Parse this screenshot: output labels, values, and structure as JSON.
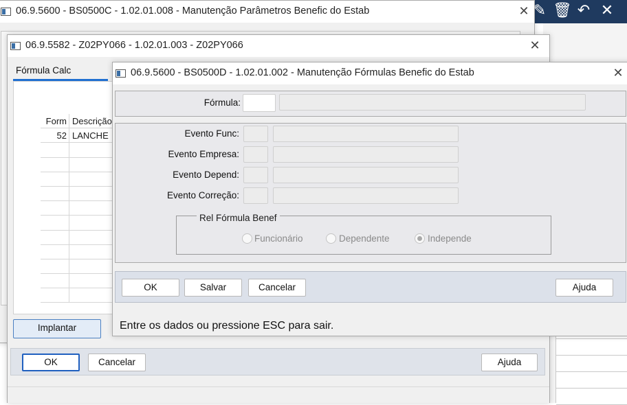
{
  "window_back": {
    "title": "06.9.5600 - BS0500C - 1.02.01.008 - Manutenção Parâmetros Benefic do Estab",
    "close": "✕"
  },
  "toolbar_icons": [
    "edit-icon",
    "trash-icon",
    "undo-icon",
    "close-icon"
  ],
  "window_middle": {
    "title": "06.9.5582 - Z02PY066 - 1.02.01.003 - Z02PY066",
    "close": "✕",
    "tab": "Fórmula Calc",
    "grid": {
      "headers": [
        "Form",
        "Descrição"
      ],
      "rows": [
        [
          "52",
          "LANCHE"
        ]
      ]
    },
    "implantar_button": "Implantar",
    "ok_button": "OK",
    "cancel_button": "Cancelar",
    "help_button": "Ajuda"
  },
  "window_front": {
    "title": "06.9.5600 - BS0500D - 1.02.01.002 - Manutenção Fórmulas Benefic do Estab",
    "close": "✕",
    "formula_label": "Fórmula:",
    "formula_value": "",
    "formula_desc": "",
    "events": [
      {
        "label": "Evento Func:",
        "code": "",
        "desc": ""
      },
      {
        "label": "Evento Empresa:",
        "code": "",
        "desc": ""
      },
      {
        "label": "Evento Depend:",
        "code": "",
        "desc": ""
      },
      {
        "label": "Evento Correção:",
        "code": "",
        "desc": ""
      }
    ],
    "rel_group": {
      "legend": "Rel Fórmula Benef",
      "options": [
        "Funcionário",
        "Dependente",
        "Independe"
      ],
      "selected": "Independe"
    },
    "ok_button": "OK",
    "save_button": "Salvar",
    "cancel_button": "Cancelar",
    "help_button": "Ajuda",
    "status": "Entre os dados ou pressione ESC para sair."
  }
}
